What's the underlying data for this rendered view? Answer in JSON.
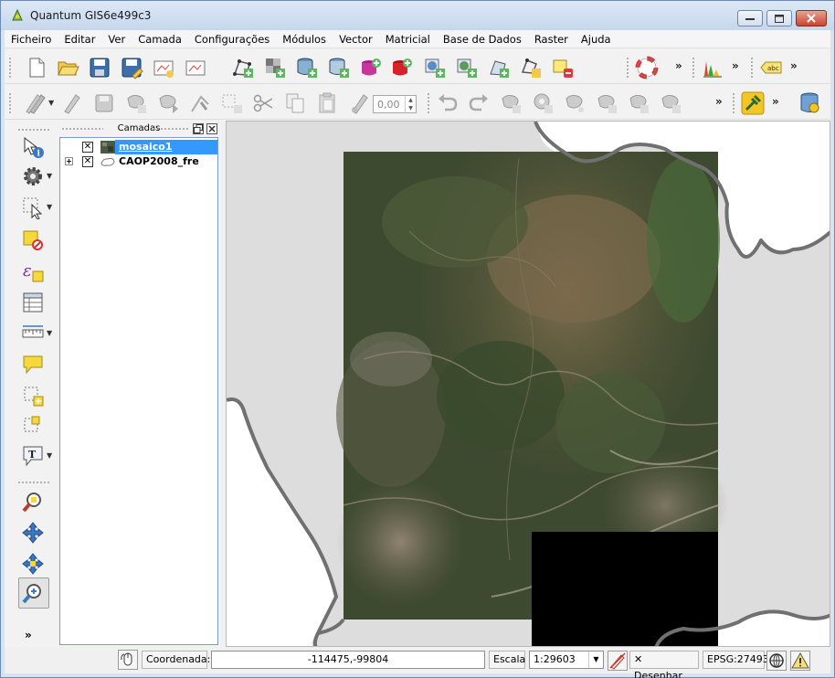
{
  "window": {
    "title": "Quantum GIS6e499c3"
  },
  "menubar": {
    "items": [
      "Ficheiro",
      "Editar",
      "Ver",
      "Camada",
      "Configurações",
      "Módulos",
      "Vector",
      "Matricial",
      "Base de Dados",
      "Raster",
      "Ajuda"
    ]
  },
  "toolbar2": {
    "spin_value": "0,00"
  },
  "layers_panel": {
    "title": "Camadas",
    "layers": [
      {
        "name": "mosaico1",
        "checked": true,
        "selected": true,
        "type": "raster"
      },
      {
        "name": "CAOP2008_fre",
        "checked": true,
        "selected": false,
        "type": "vector",
        "expandable": true
      }
    ]
  },
  "statusbar": {
    "coordinate_label": "Coordenada:",
    "coordinate_value": "-114475,-99804",
    "scale_label": "Escala",
    "scale_value": "1:29603",
    "render_label": "Desenhar",
    "crs": "EPSG:27493"
  },
  "colors": {
    "accent": "#3399ff",
    "boundary": "#707070",
    "nodata": "#000000"
  }
}
